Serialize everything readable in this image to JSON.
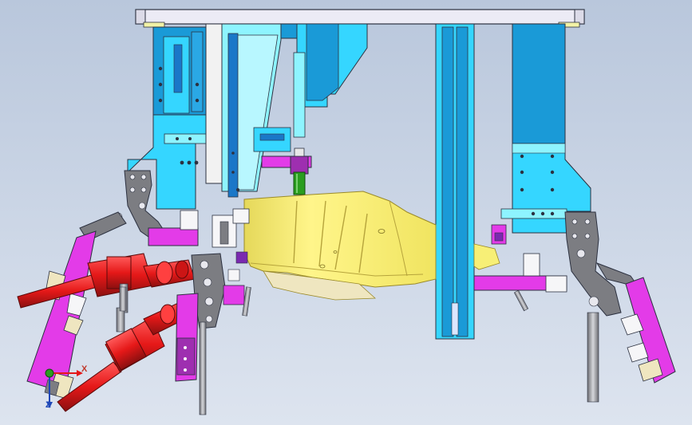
{
  "viewport": {
    "background_top": "#b9c7dc",
    "background_bottom": "#dde4ef"
  },
  "colors": {
    "cyan": "#35d6ff",
    "blue": "#1a9ad7",
    "light_cyan": "#8ef4ff",
    "yellow": "#f7f06c",
    "yellow_dark": "#c9b73e",
    "magenta": "#e33be8",
    "red": "#e51818",
    "red_dark": "#8b1010",
    "gray": "#7c7d82",
    "gray_light": "#c7c7cb",
    "white": "#f6f6f8",
    "green": "#2a9d1f",
    "beige": "#efe6c0",
    "outline": "#2c3140"
  },
  "triad": {
    "x_label": "X",
    "z_label": "Z",
    "icon": "axis-triad-icon"
  }
}
